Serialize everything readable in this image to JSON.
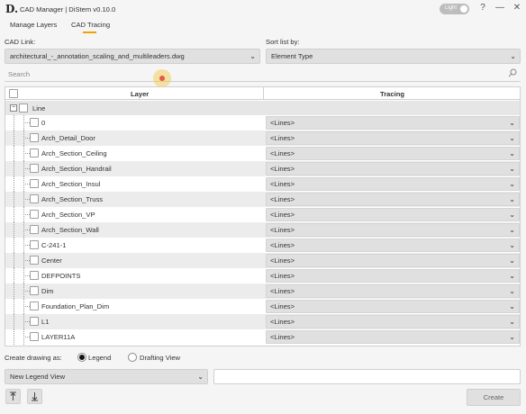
{
  "window": {
    "logo": "D.",
    "title": "CAD Manager | DiStem v0.10.0",
    "theme_label": "Light",
    "help": "?",
    "minimize": "—",
    "close": "✕"
  },
  "tabs": [
    {
      "label": "Manage Layers",
      "active": false
    },
    {
      "label": "CAD Tracing",
      "active": true
    }
  ],
  "cad_link": {
    "label": "CAD Link:",
    "value": "architectural_-_annotation_scaling_and_multileaders.dwg"
  },
  "sort_list": {
    "label": "Sort list by:",
    "value": "Element Type"
  },
  "search": {
    "placeholder": "Search"
  },
  "table": {
    "headers": {
      "layer": "Layer",
      "tracing": "Tracing"
    },
    "group": {
      "label": "Line",
      "expander": "−"
    },
    "rows": [
      {
        "layer": "0",
        "tracing": "<Lines>"
      },
      {
        "layer": "Arch_Detail_Door",
        "tracing": "<Lines>"
      },
      {
        "layer": "Arch_Section_Ceiling",
        "tracing": "<Lines>"
      },
      {
        "layer": "Arch_Section_Handrail",
        "tracing": "<Lines>"
      },
      {
        "layer": "Arch_Section_Insul",
        "tracing": "<Lines>"
      },
      {
        "layer": "Arch_Section_Truss",
        "tracing": "<Lines>"
      },
      {
        "layer": "Arch_Section_VP",
        "tracing": "<Lines>"
      },
      {
        "layer": "Arch_Section_Wall",
        "tracing": "<Lines>"
      },
      {
        "layer": "C-241-1",
        "tracing": "<Lines>"
      },
      {
        "layer": "Center",
        "tracing": "<Lines>"
      },
      {
        "layer": "DEFPOINTS",
        "tracing": "<Lines>"
      },
      {
        "layer": "Dim",
        "tracing": "<Lines>"
      },
      {
        "layer": "Foundation_Plan_Dim",
        "tracing": "<Lines>"
      },
      {
        "layer": "L1",
        "tracing": "<Lines>"
      },
      {
        "layer": "LAYER11A",
        "tracing": "<Lines>"
      }
    ]
  },
  "create_drawing": {
    "label": "Create drawing as:",
    "options": [
      {
        "label": "Legend",
        "selected": true
      },
      {
        "label": "Drafting View",
        "selected": false
      }
    ]
  },
  "view_select": {
    "value": "New Legend View"
  },
  "name_input": {
    "value": ""
  },
  "buttons": {
    "create": "Create"
  },
  "colors": {
    "accent": "#f0a300",
    "cursor_dot": "#e25a4a"
  }
}
